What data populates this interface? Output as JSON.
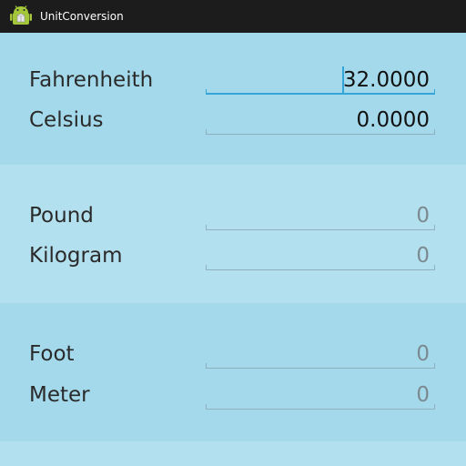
{
  "app": {
    "title": "UnitConversion",
    "icon": "android-app-icon"
  },
  "colors": {
    "section_dark": "#a3d9eb",
    "section_light": "#b3e0ee",
    "focus_accent": "#33a5d8"
  },
  "temperature": {
    "fahrenheit": {
      "label": "Fahrenheith",
      "value": "32.0000"
    },
    "celsius": {
      "label": "Celsius",
      "value": "0.0000"
    }
  },
  "weight": {
    "pound": {
      "label": "Pound",
      "hint": "0"
    },
    "kilogram": {
      "label": "Kilogram",
      "hint": "0"
    }
  },
  "length": {
    "foot": {
      "label": "Foot",
      "hint": "0"
    },
    "meter": {
      "label": "Meter",
      "hint": "0"
    }
  }
}
